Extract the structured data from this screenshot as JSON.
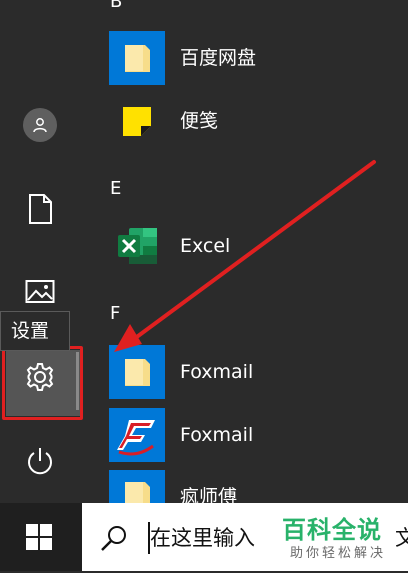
{
  "start_menu": {
    "tooltip": "设置",
    "rail": {
      "items": [
        {
          "name": "user-account",
          "icon": "user-icon"
        },
        {
          "name": "documents",
          "icon": "document-icon"
        },
        {
          "name": "pictures",
          "icon": "picture-icon"
        },
        {
          "name": "settings",
          "icon": "gear-icon"
        },
        {
          "name": "power",
          "icon": "power-icon"
        }
      ]
    },
    "groups": [
      {
        "letter": "B",
        "apps": [
          {
            "label": "百度网盘",
            "icon": "folder-icon"
          },
          {
            "label": "便笺",
            "icon": "sticky-notes-icon"
          }
        ]
      },
      {
        "letter": "E",
        "apps": [
          {
            "label": "Excel",
            "icon": "excel-icon"
          }
        ]
      },
      {
        "letter": "F",
        "apps": [
          {
            "label": "Foxmail",
            "icon": "folder-icon"
          },
          {
            "label": "Foxmail",
            "icon": "foxmail-icon"
          },
          {
            "label": "疯师傅",
            "icon": "folder-icon"
          }
        ]
      }
    ]
  },
  "taskbar": {
    "start_icon": "windows-logo-icon",
    "search": {
      "placeholder": "在这里输入",
      "trailing_text": "文"
    }
  },
  "annotation": {
    "highlight_color": "#e02020",
    "arrow_color": "#e02020"
  },
  "watermark": {
    "title": "百科全说",
    "subtitle": "助你轻松解决"
  },
  "colors": {
    "tile_blue": "#0078d7",
    "folder_yellow": "#f7dd8a",
    "excel_green": "#1d6f42",
    "sticky_yellow": "#ffe100",
    "foxmail_red": "#d81e27"
  }
}
